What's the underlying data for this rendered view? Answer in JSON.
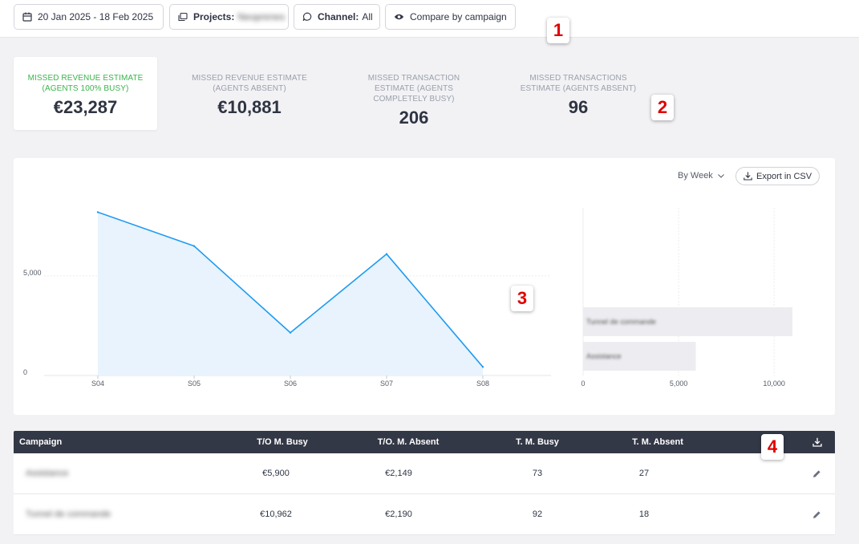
{
  "filters": {
    "date_range": "20 Jan 2025 - 18 Feb 2025",
    "projects_label": "Projects:",
    "projects_value": "Neoprenes",
    "channel_label": "Channel:",
    "channel_value": "All",
    "compare_label": "Compare by campaign"
  },
  "annotations": [
    "1",
    "2",
    "3",
    "4"
  ],
  "kpis": [
    {
      "label_line1": "MISSED REVENUE ESTIMATE",
      "label_line2": "(AGENTS 100% BUSY)",
      "value": "€23,287",
      "color": "#39b54a"
    },
    {
      "label_line1": "MISSED REVENUE ESTIMATE",
      "label_line2": "(AGENTS ABSENT)",
      "value": "€10,881"
    },
    {
      "label_line1": "MISSED TRANSACTION",
      "label_line2": "ESTIMATE (AGENTS",
      "label_line3": "COMPLETELY BUSY)",
      "value": "206"
    },
    {
      "label_line1": "MISSED TRANSACTIONS",
      "label_line2": "ESTIMATE (AGENTS ABSENT)",
      "value": "96"
    }
  ],
  "chart_controls": {
    "granularity": "By Week",
    "export_label": "Export in CSV"
  },
  "chart_data": [
    {
      "type": "area",
      "x": [
        "S04",
        "S05",
        "S06",
        "S07",
        "S08"
      ],
      "values": [
        8200,
        6500,
        2150,
        6100,
        430
      ],
      "ylim": [
        0,
        8500
      ],
      "yticks": [
        "0",
        "5,000"
      ],
      "grid": true,
      "color": "#1f9bf0"
    },
    {
      "type": "bar",
      "orientation": "horizontal",
      "categories": [
        "Tunnel de commande",
        "Assistance"
      ],
      "values": [
        10962,
        5900
      ],
      "xlim": [
        0,
        11000
      ],
      "xticks": [
        "0",
        "5,000",
        "10,000"
      ],
      "color": "#ededf1"
    }
  ],
  "table": {
    "headers": [
      "Campaign",
      "T/O M. Busy",
      "T/O. M. Absent",
      "T. M. Busy",
      "T. M. Absent"
    ],
    "rows": [
      {
        "campaign": "Assistance",
        "to_busy": "€5,900",
        "to_absent": "€2,149",
        "t_busy": "73",
        "t_absent": "27"
      },
      {
        "campaign": "Tunnel de commande",
        "to_busy": "€10,962",
        "to_absent": "€2,190",
        "t_busy": "92",
        "t_absent": "18"
      }
    ]
  },
  "icons": {
    "calendar": "calendar-icon",
    "projects": "folders-icon",
    "channel": "chat-bubble-icon",
    "compare": "eye-icon",
    "download": "download-icon",
    "edit": "pencil-icon"
  }
}
